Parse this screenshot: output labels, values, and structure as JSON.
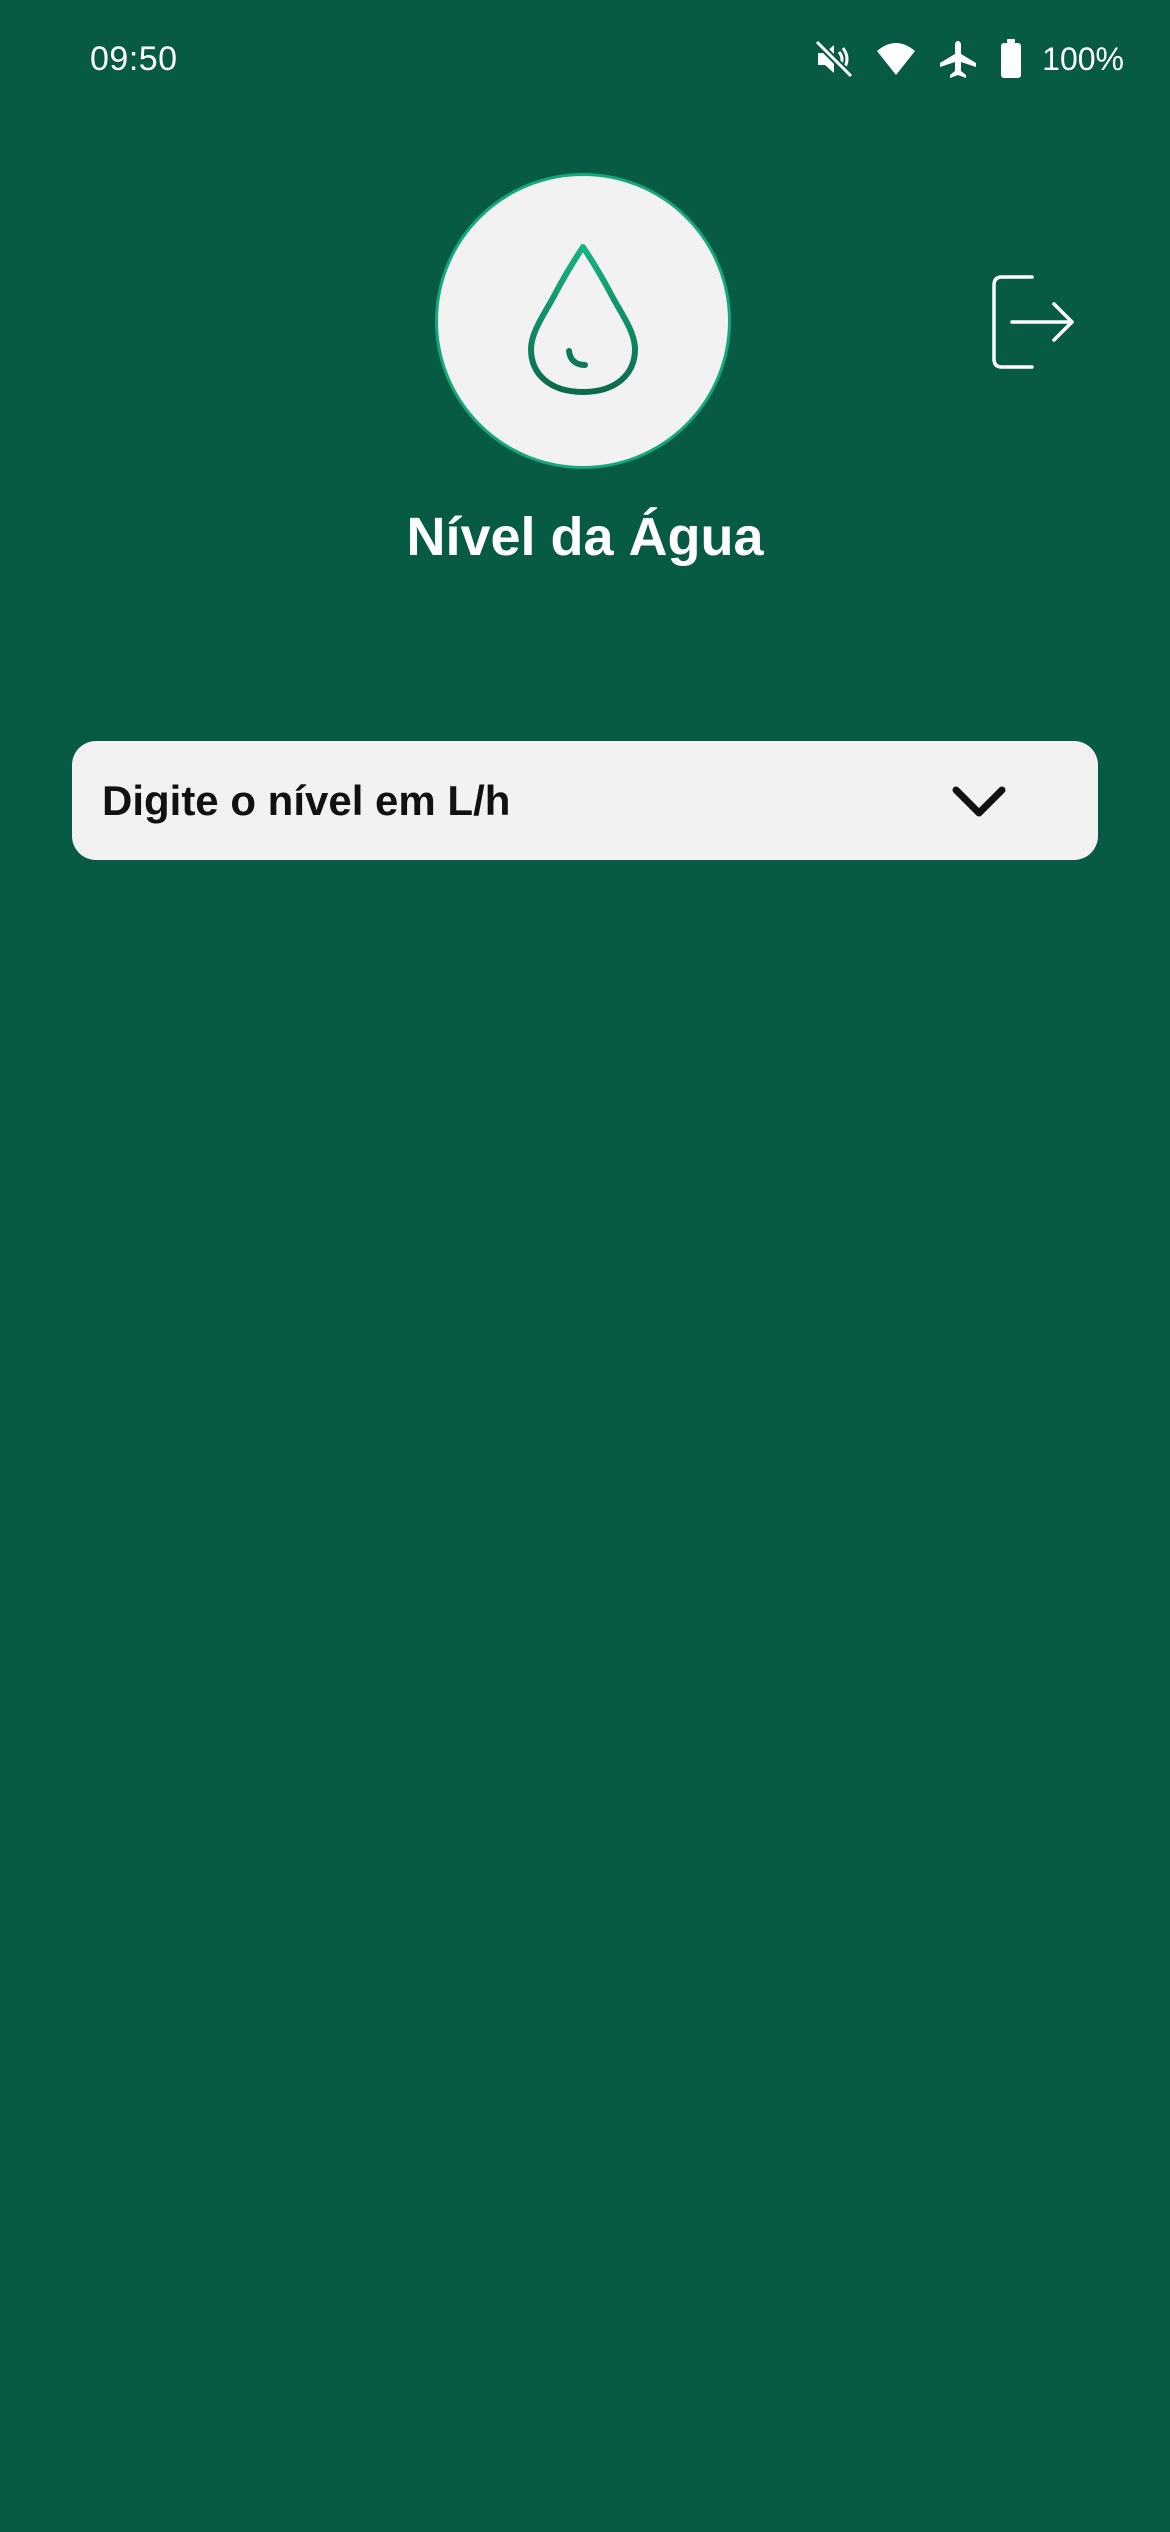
{
  "status_bar": {
    "time": "09:50",
    "icons": [
      "mute-icon",
      "wifi-icon",
      "airplane-mode-icon",
      "battery-icon"
    ],
    "battery_percent": "100%"
  },
  "header": {
    "logo_icon": "water-drop-icon",
    "logout_icon": "logout-icon",
    "title": "Nível da Água"
  },
  "form": {
    "level_select": {
      "placeholder": "Digite o nível em L/h",
      "icon": "chevron-down-icon"
    }
  },
  "colors": {
    "background": "#075b44",
    "accent": "#16a77a",
    "card": "#f2f2f2",
    "text_light": "#ffffff",
    "text_dark": "#111111"
  }
}
